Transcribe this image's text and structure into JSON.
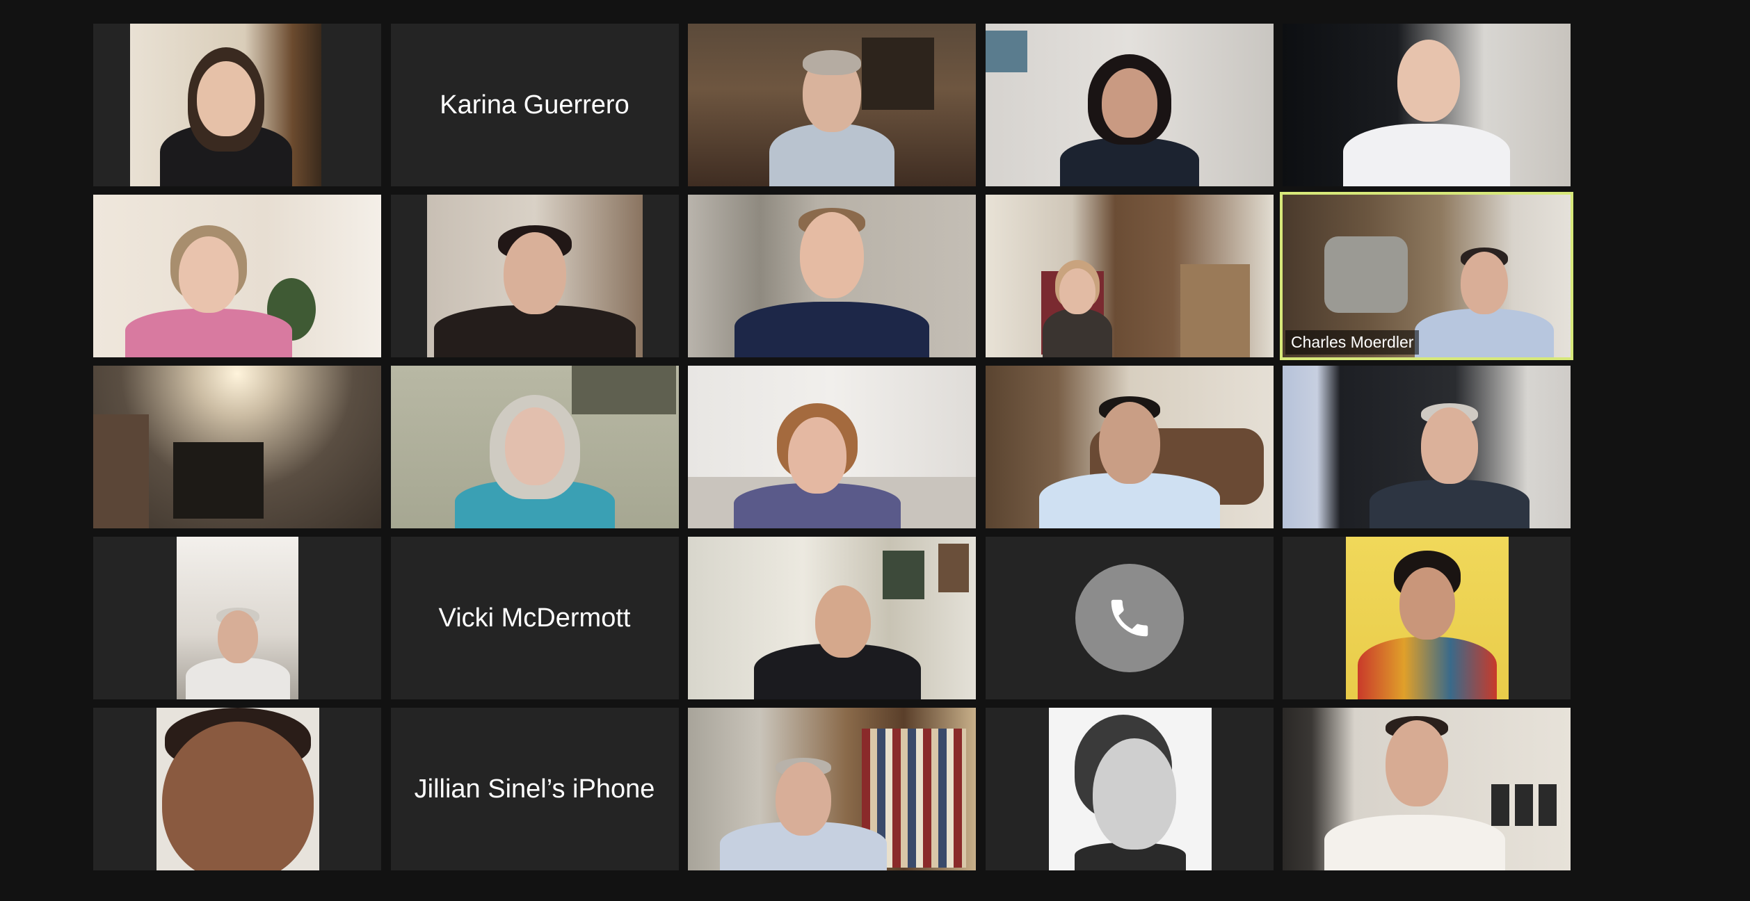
{
  "app": "Video meeting gallery view",
  "tiles": [
    {
      "kind": "video",
      "name": ""
    },
    {
      "kind": "name",
      "name": "Karina Guerrero"
    },
    {
      "kind": "video",
      "name": ""
    },
    {
      "kind": "video",
      "name": ""
    },
    {
      "kind": "video",
      "name": ""
    },
    {
      "kind": "video",
      "name": ""
    },
    {
      "kind": "video",
      "name": ""
    },
    {
      "kind": "video",
      "name": ""
    },
    {
      "kind": "video",
      "name": ""
    },
    {
      "kind": "video",
      "name": "Charles Moerdler",
      "active": true
    },
    {
      "kind": "video",
      "name": ""
    },
    {
      "kind": "video",
      "name": ""
    },
    {
      "kind": "video",
      "name": ""
    },
    {
      "kind": "video",
      "name": ""
    },
    {
      "kind": "video",
      "name": ""
    },
    {
      "kind": "video",
      "name": ""
    },
    {
      "kind": "name",
      "name": "Vicki McDermott"
    },
    {
      "kind": "video",
      "name": ""
    },
    {
      "kind": "phone",
      "name": ""
    },
    {
      "kind": "video",
      "name": ""
    },
    {
      "kind": "video",
      "name": ""
    },
    {
      "kind": "name",
      "name": "Jillian Sinel’s iPhone"
    },
    {
      "kind": "video",
      "name": ""
    },
    {
      "kind": "video",
      "name": ""
    },
    {
      "kind": "video",
      "name": ""
    }
  ],
  "colors": {
    "background": "#121212",
    "tile": "#242424",
    "active_border": "#d7e87a",
    "phone_circle": "#8c8c8c"
  },
  "icons": {
    "phone": "phone-icon"
  }
}
